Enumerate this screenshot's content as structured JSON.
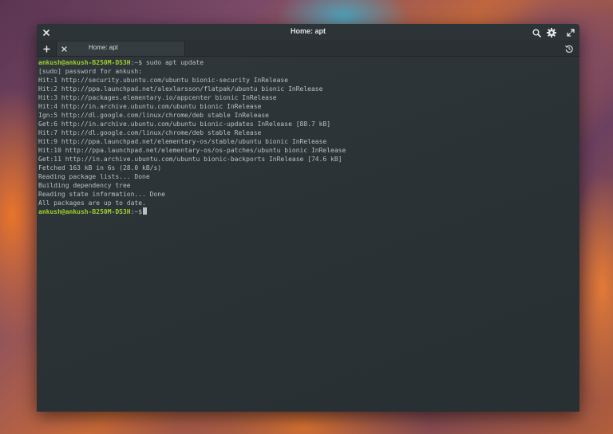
{
  "window": {
    "title": "Home: apt"
  },
  "tabs": [
    {
      "label": "Home: apt"
    }
  ],
  "terminal": {
    "command_prompt": {
      "user_host": "ankush@ankush-B250M-DS3H",
      "path_sign": ":~$",
      "command": " sudo apt update"
    },
    "output": [
      "[sudo] password for ankush:",
      "Hit:1 http://security.ubuntu.com/ubuntu bionic-security InRelease",
      "Hit:2 http://ppa.launchpad.net/alexlarsson/flatpak/ubuntu bionic InRelease",
      "Hit:3 http://packages.elementary.io/appcenter bionic InRelease",
      "Hit:4 http://in.archive.ubuntu.com/ubuntu bionic InRelease",
      "Ign:5 http://dl.google.com/linux/chrome/deb stable InRelease",
      "Get:6 http://in.archive.ubuntu.com/ubuntu bionic-updates InRelease [88.7 kB]",
      "Hit:7 http://dl.google.com/linux/chrome/deb stable Release",
      "Hit:9 http://ppa.launchpad.net/elementary-os/stable/ubuntu bionic InRelease",
      "Hit:10 http://ppa.launchpad.net/elementary-os/os-patches/ubuntu bionic InRelease",
      "Get:11 http://in.archive.ubuntu.com/ubuntu bionic-backports InRelease [74.6 kB]",
      "Fetched 163 kB in 6s (28.0 kB/s)",
      "Reading package lists... Done",
      "Building dependency tree",
      "Reading state information... Done",
      "All packages are up to date."
    ],
    "final_prompt": {
      "user_host": "ankush@ankush-B250M-DS3H",
      "path_sign": ":~$"
    }
  },
  "colors": {
    "terminal_bg": "#2a3134",
    "prompt_green": "#9fcf2f",
    "text": "#b9c0c0"
  }
}
